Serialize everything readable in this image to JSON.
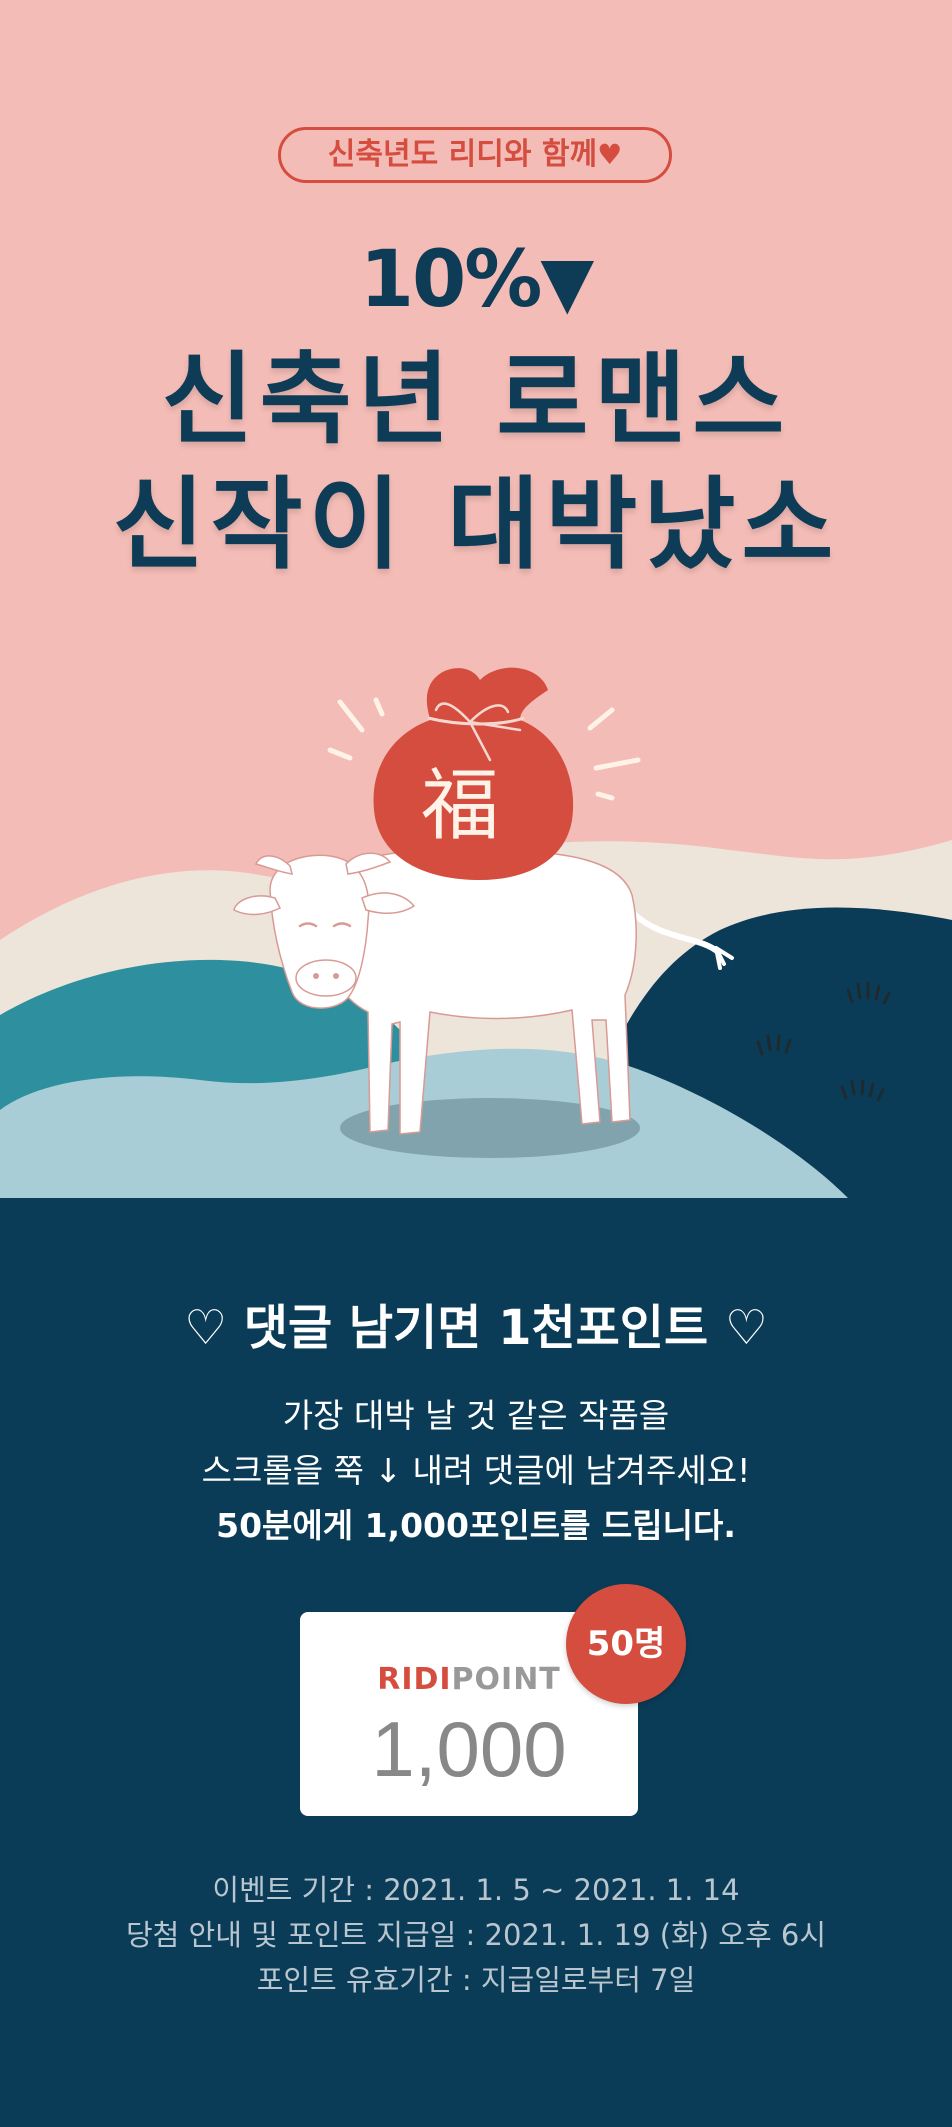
{
  "hero": {
    "tag_text": "신축년도 리디와 함께",
    "tag_heart": "♥",
    "discount": "10%",
    "discount_arrow": "▼",
    "headline_line1": "신축년 로맨스",
    "headline_line2": "신작이 대박났소",
    "bag_character": "福"
  },
  "event": {
    "title": "♡ 댓글 남기면 1천포인트 ♡",
    "desc_line1": "가장 대박 날 것 같은 작품을",
    "desc_line2": "스크롤을 쭉 ↓ 내려 댓글에 남겨주세요!",
    "desc_line3": "50분에게 1,000포인트를 드립니다.",
    "card": {
      "brand_red": "RIDI",
      "brand_gray": "POINT",
      "amount": "1,000",
      "badge": "50명"
    },
    "period": "이벤트 기간 : 2021. 1. 5 ~ 2021. 1. 14",
    "announce": "당첨 안내 및 포인트 지급일 : 2021. 1. 19 (화) 오후 6시",
    "validity": "포인트 유효기간 : 지급일로부터 7일"
  },
  "colors": {
    "pink_bg": "#F4BCB6",
    "navy": "#0B3C57",
    "red": "#D44D3F",
    "teal": "#2E8F9E",
    "light_blue": "#A8CDD6",
    "cream": "#EDE4DA"
  }
}
